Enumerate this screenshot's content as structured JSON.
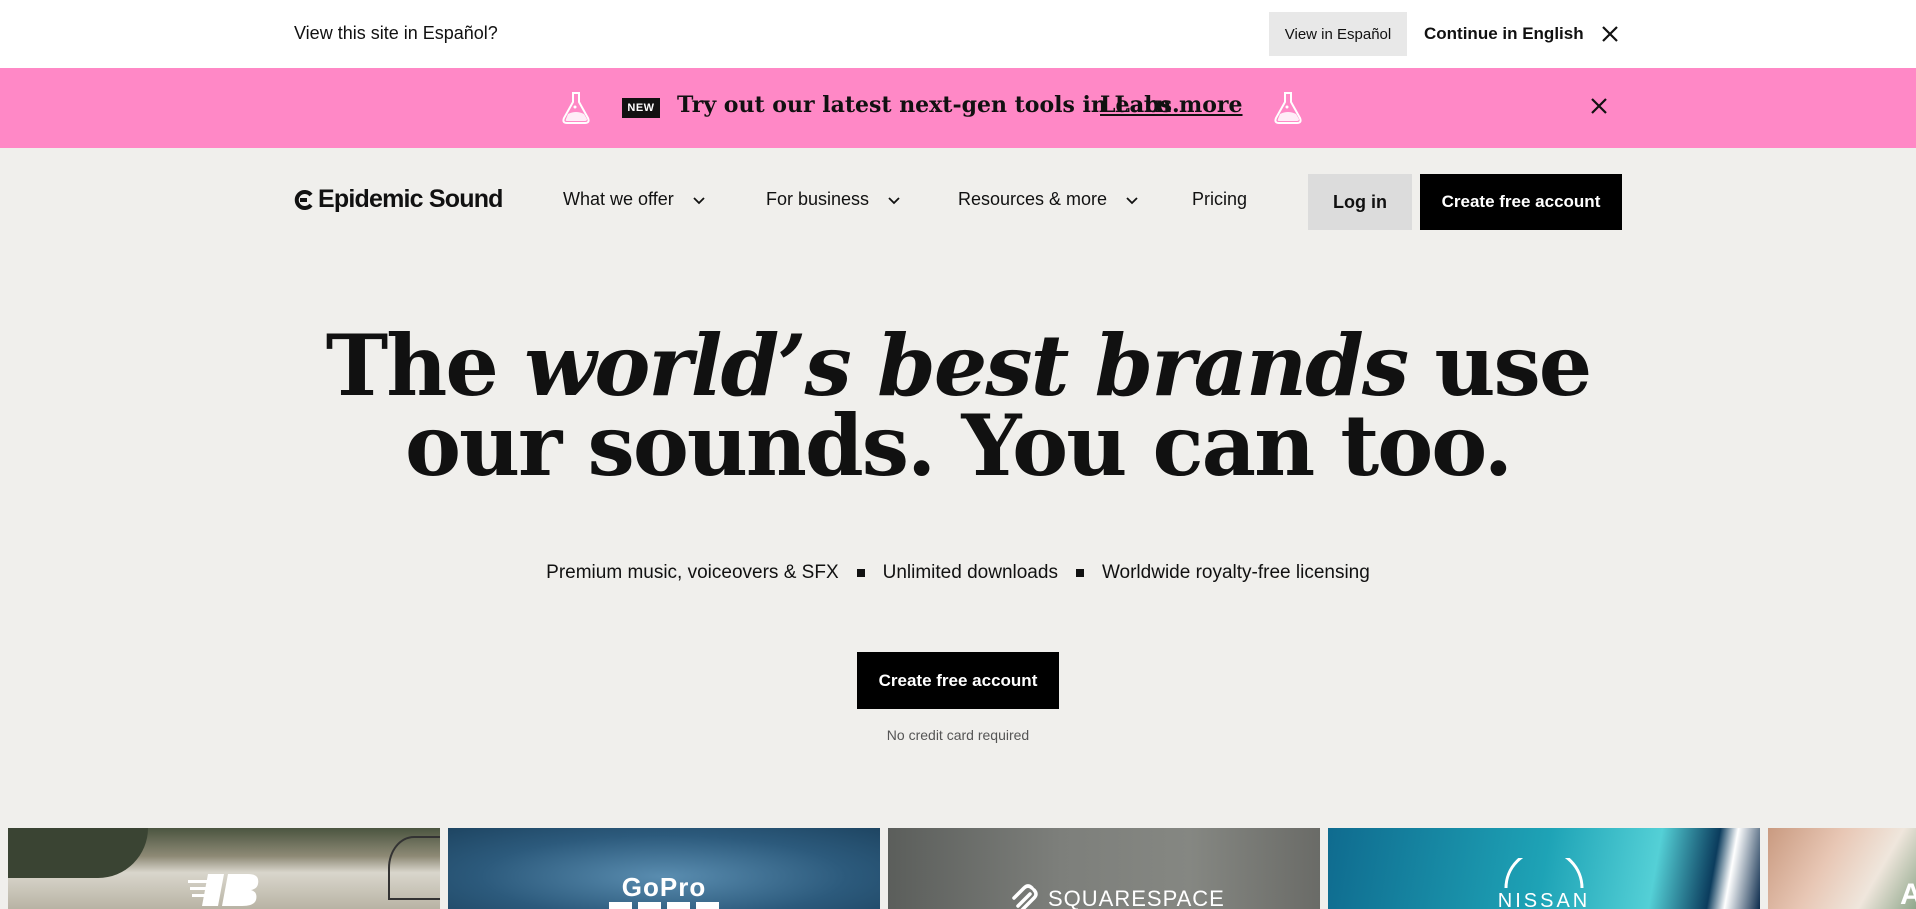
{
  "language_bar": {
    "question": "View this site in Español?",
    "view_spanish": "View in Español",
    "continue_english": "Continue in English"
  },
  "promo": {
    "badge": "NEW",
    "text": "Try out our latest next-gen tools in Labs.",
    "link": "Learn more",
    "bg_color": "#ff88c6"
  },
  "nav": {
    "logo": "Epidemic Sound",
    "items": [
      {
        "label": "What we offer",
        "has_dropdown": true
      },
      {
        "label": "For business",
        "has_dropdown": true
      },
      {
        "label": "Resources & more",
        "has_dropdown": true
      },
      {
        "label": "Pricing",
        "has_dropdown": false
      }
    ],
    "login": "Log in",
    "create_account": "Create free account"
  },
  "hero": {
    "title_part1": "The ",
    "title_italic": "world’s best brands",
    "title_part2": " use",
    "title_line2": "our sounds. You can too.",
    "features": [
      "Premium music, voiceovers & SFX",
      "Unlimited downloads",
      "Worldwide royalty-free licensing"
    ],
    "cta": "Create free account",
    "note": "No credit card required"
  },
  "brands": [
    {
      "name": "New Balance",
      "icon": "new-balance-logo"
    },
    {
      "name": "GoPro",
      "icon": "gopro-logo"
    },
    {
      "name": "SQUARESPACE",
      "icon": "squarespace-logo"
    },
    {
      "name": "NISSAN",
      "icon": "nissan-logo"
    },
    {
      "name": "A",
      "icon": "partial-logo"
    }
  ]
}
